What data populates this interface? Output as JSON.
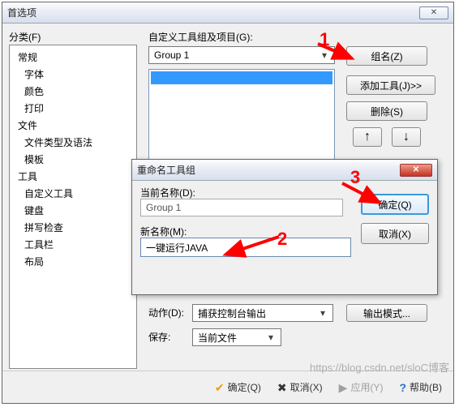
{
  "main": {
    "title": "首选项",
    "sidebar_label": "分类(F)",
    "tree": {
      "groups": [
        {
          "label": "常规",
          "children": [
            "字体",
            "颜色",
            "打印"
          ]
        },
        {
          "label": "文件",
          "children": [
            "文件类型及语法",
            "模板"
          ]
        },
        {
          "label": "工具",
          "children": [
            "自定义工具",
            "键盘",
            "拼写检查",
            "工具栏",
            "布局"
          ]
        }
      ],
      "selected": "自定义工具"
    },
    "right_label": "自定义工具组及项目(G):",
    "group_dropdown": {
      "value": "Group 1"
    },
    "buttons": {
      "groupname": "组名(Z)",
      "addtool": "添加工具(J)>>",
      "delete": "删除(S)",
      "up": "↑",
      "down": "↓",
      "output_mode": "输出模式..."
    },
    "action_label": "动作(D):",
    "action_value": "捕获控制台输出",
    "save_label": "保存:",
    "save_value": "当前文件",
    "footer": {
      "ok": "确定(Q)",
      "cancel": "取消(X)",
      "apply": "应用(Y)",
      "help": "帮助(B)"
    }
  },
  "child": {
    "title": "重命名工具组",
    "current_label": "当前名称(D):",
    "current_value": "Group 1",
    "new_label": "新名称(M):",
    "new_value": "一键运行JAVA",
    "ok": "确定(Q)",
    "cancel": "取消(X)"
  },
  "annotations": {
    "n1": "1",
    "n2": "2",
    "n3": "3"
  },
  "watermark": "https://blog.csdn.net/sloC博客"
}
